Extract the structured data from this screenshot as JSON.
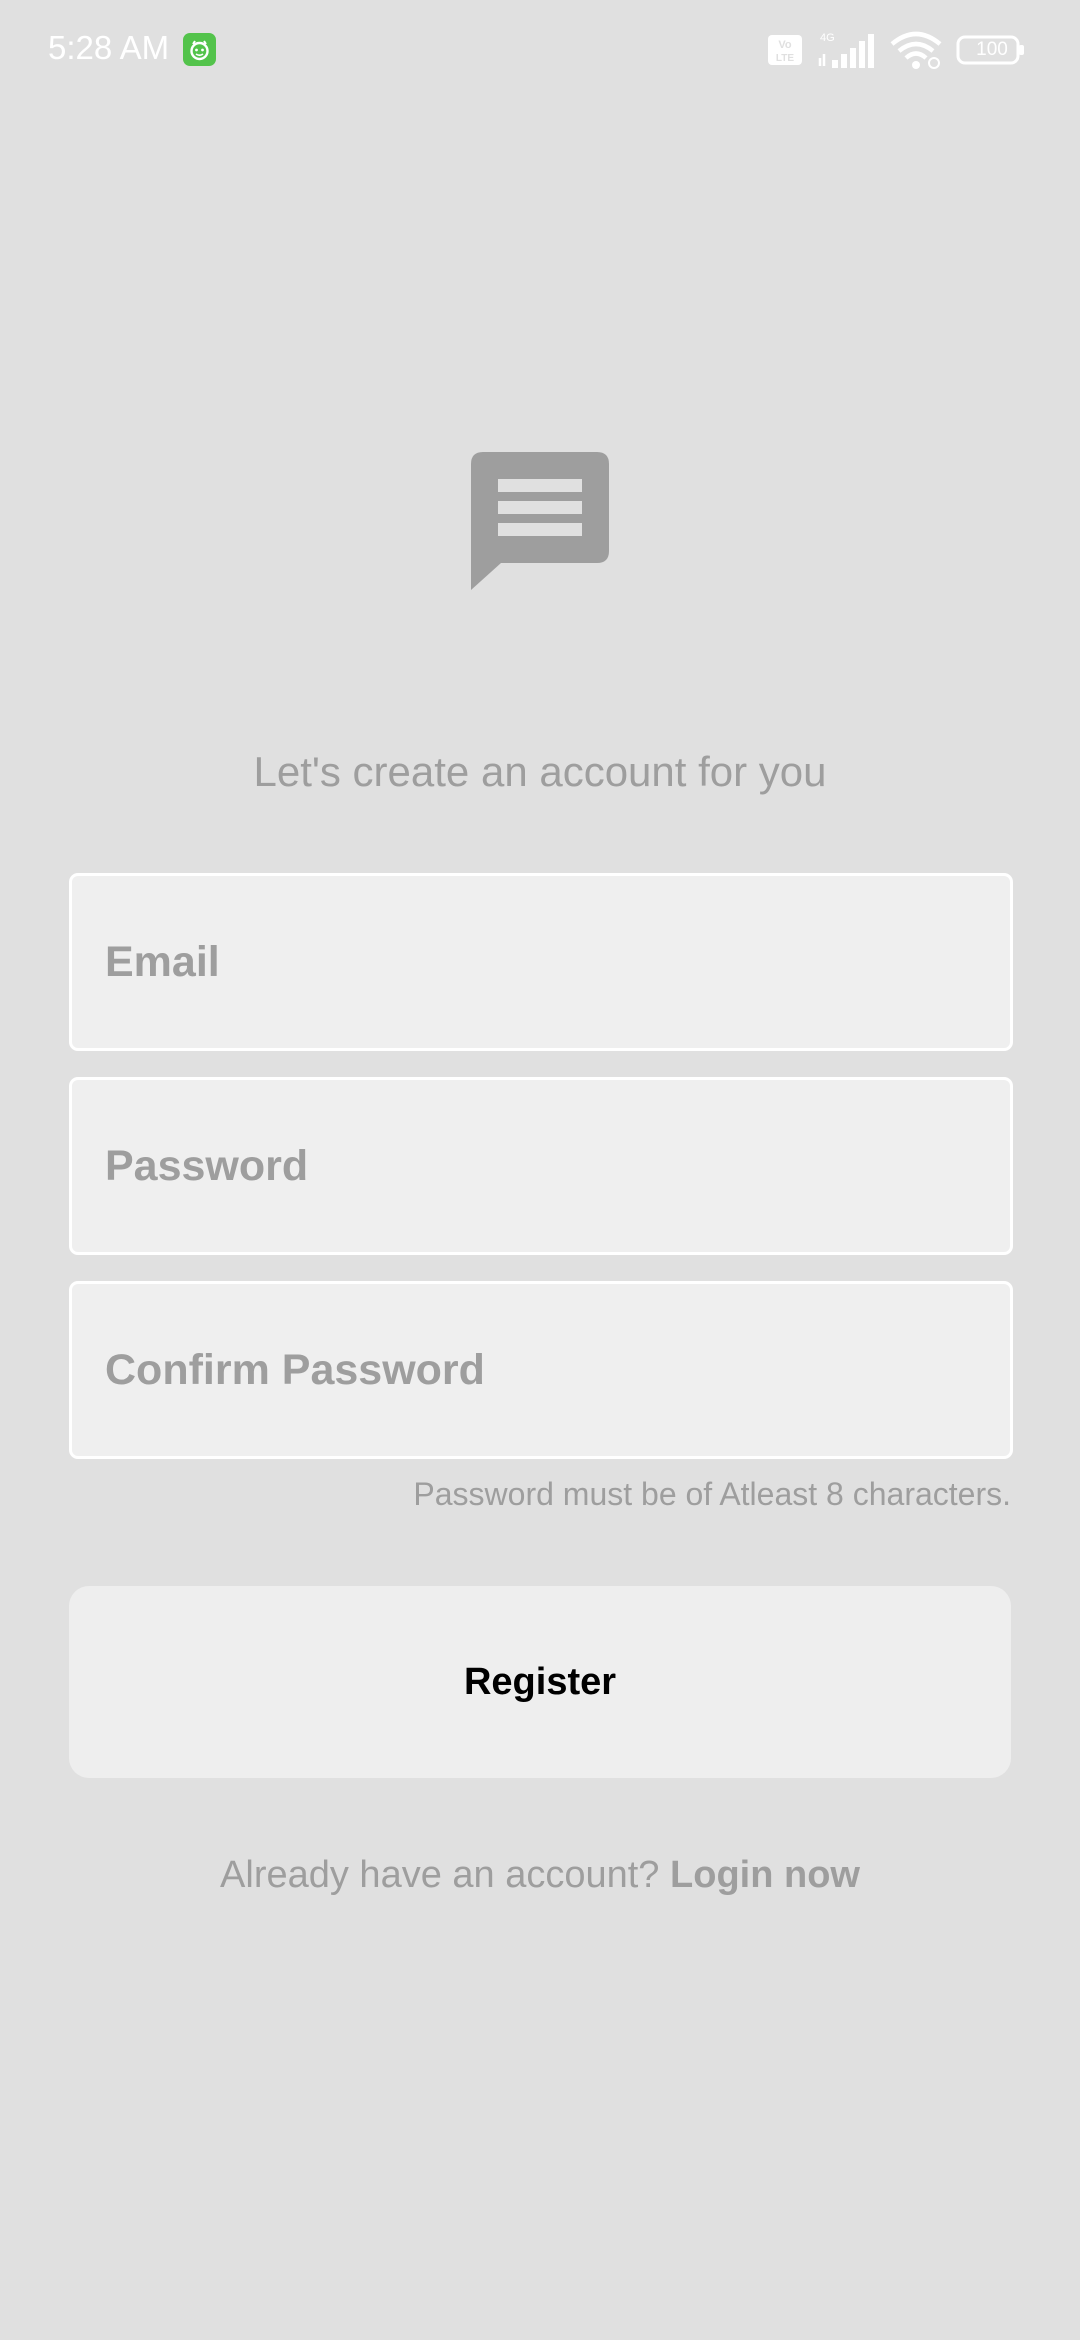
{
  "status_bar": {
    "time": "5:28 AM",
    "battery": "100",
    "network": "4G",
    "volte": "Vo LTE",
    "icons": [
      "app-notification-icon",
      "volte-icon",
      "signal-icon",
      "wifi-icon",
      "battery-icon"
    ]
  },
  "logo": {
    "icon": "message-icon",
    "color": "#9e9e9e"
  },
  "subtitle": "Let's create an account for you",
  "form": {
    "email_placeholder": "Email",
    "password_placeholder": "Password",
    "confirm_password_placeholder": "Confirm Password",
    "hint": "Password must be of Atleast 8 characters."
  },
  "register_label": "Register",
  "footer": {
    "prompt": "Already have an account?",
    "link": "Login now"
  },
  "colors": {
    "background": "#e0e0e0",
    "field_background": "#efefef",
    "muted_text": "#9e9e9e",
    "app_icon_green": "#53c34b"
  }
}
